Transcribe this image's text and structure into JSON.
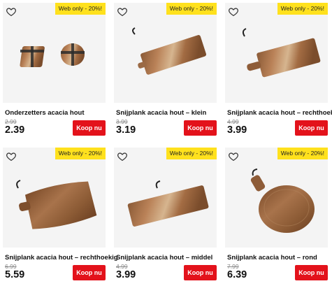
{
  "colors": {
    "badge": "#ffe11d",
    "buy_button": "#e3121b",
    "card_bg": "#f4f4f4"
  },
  "products": [
    {
      "badge": "Web only - 20%!",
      "title": "Onderzetters acacia hout",
      "old_price": "2.99",
      "price": "2.39",
      "buy_label": "Koop nu",
      "icon": "heart-outline-icon"
    },
    {
      "badge": "Web only - 20%!",
      "title": "Snijplank acacia hout – klein",
      "old_price": "3.99",
      "price": "3.19",
      "buy_label": "Koop nu",
      "icon": "heart-outline-icon"
    },
    {
      "badge": "Web only - 20%!",
      "title": "Snijplank acacia hout – rechthoekig",
      "old_price": "4.99",
      "price": "3.99",
      "buy_label": "Koop nu",
      "icon": "heart-outline-icon"
    },
    {
      "badge": "Web only - 20%!",
      "title": "Snijplank acacia hout – rechthoekig",
      "old_price": "6.99",
      "price": "5.59",
      "buy_label": "Koop nu",
      "icon": "heart-outline-icon"
    },
    {
      "badge": "Web only - 20%!",
      "title": "Snijplank acacia hout – middel",
      "old_price": "4.99",
      "price": "3.99",
      "buy_label": "Koop nu",
      "icon": "heart-outline-icon"
    },
    {
      "badge": "Web only - 20%!",
      "title": "Snijplank acacia hout – rond",
      "old_price": "7.99",
      "price": "6.39",
      "buy_label": "Koop nu",
      "icon": "heart-outline-icon"
    }
  ]
}
